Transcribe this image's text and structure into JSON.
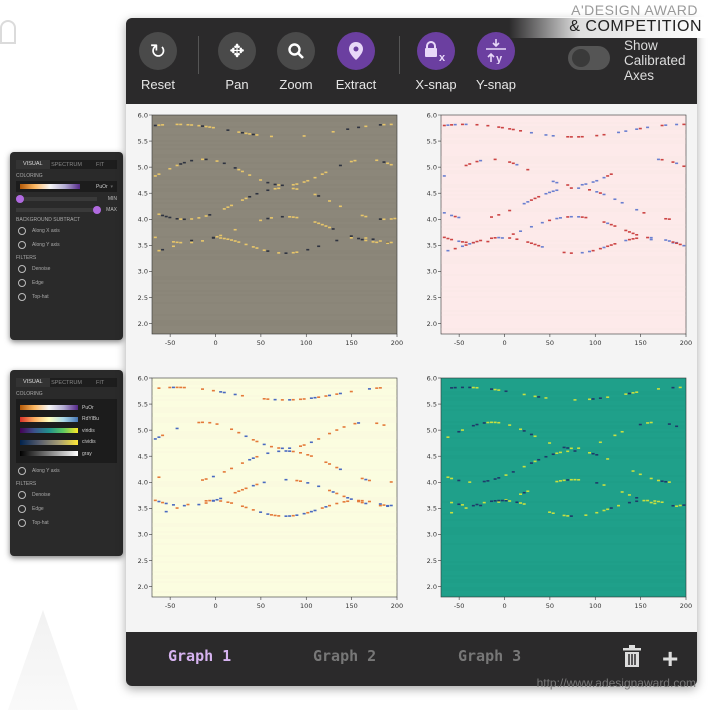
{
  "watermark": {
    "line1": "A'DESIGN AWARD",
    "line2": "& COMPETITION",
    "url": "http://www.adesignaward.com"
  },
  "panel1": {
    "tabs": [
      "VISUAL",
      "SPECTRUM",
      "FIT"
    ],
    "coloring_label": "COLORING",
    "colormap": "PuOr",
    "min_label": "MIN",
    "max_label": "MAX",
    "min_value": 0.0,
    "max_value": 0.9,
    "bg_label": "BACKGROUND SUBTRACT",
    "bg_options": [
      "Along X axis",
      "Along Y axis"
    ],
    "filters_label": "FILTERS",
    "filters": [
      "Denoise",
      "Edge",
      "Top-hat"
    ]
  },
  "panel2": {
    "tabs": [
      "VISUAL",
      "SPECTRUM",
      "FIT"
    ],
    "coloring_label": "COLORING",
    "colormaps": [
      "PuOr",
      "RdYlBu",
      "viridis",
      "cividis",
      "gray"
    ],
    "bg_options": [
      "Along Y axis"
    ],
    "filters_label": "FILTERS",
    "filters": [
      "Denoise",
      "Edge",
      "Top-hat"
    ]
  },
  "toolbar": {
    "reset": "Reset",
    "pan": "Pan",
    "zoom": "Zoom",
    "extract": "Extract",
    "xsnap": "X-snap",
    "ysnap": "Y-snap",
    "calibrated": "Show Calibrated Axes",
    "calibrated_on": false,
    "accent": "#6b3fa0"
  },
  "plots": [
    {
      "colormap": "PuOr",
      "background": "#8c877a"
    },
    {
      "colormap": "RdYlBu",
      "background": "#fdeaea"
    },
    {
      "colormap": "RdYlBu-light",
      "background": "#fbfde0"
    },
    {
      "colormap": "viridis",
      "background": "#1fa08a"
    }
  ],
  "axes": {
    "x_ticks": [
      "-50",
      "0",
      "50",
      "100",
      "150",
      "200"
    ],
    "y_ticks": [
      "2.0",
      "2.5",
      "3.0",
      "3.5",
      "4.0",
      "4.5",
      "5.0",
      "5.5",
      "6.0"
    ],
    "xlim": [
      -70,
      200
    ],
    "ylim": [
      1.8,
      6.0
    ]
  },
  "bottom": {
    "tabs": [
      "Graph 1",
      "Graph 2",
      "Graph 3"
    ],
    "active": 0
  }
}
